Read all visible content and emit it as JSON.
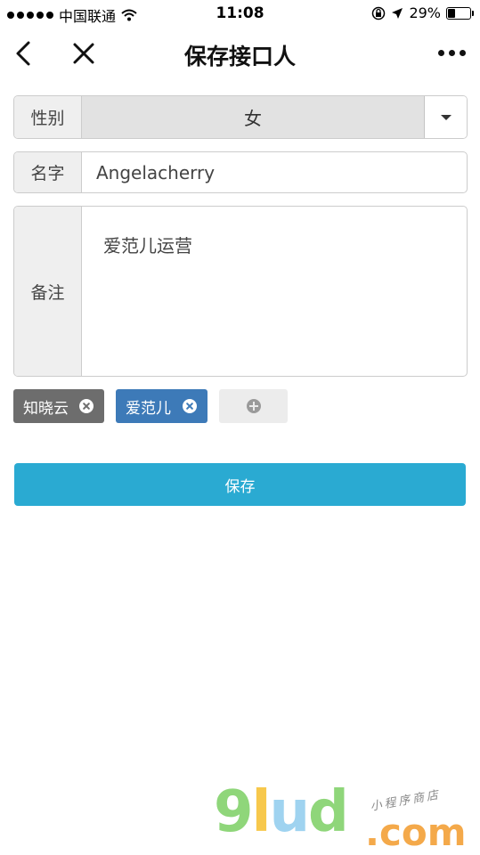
{
  "status_bar": {
    "carrier": "中国联通",
    "time": "11:08",
    "battery_text": "29%",
    "battery_level": 0.29,
    "icons": [
      "signal-dots",
      "wifi-icon",
      "rotation-lock-icon",
      "location-arrow-icon",
      "battery-icon"
    ]
  },
  "nav": {
    "title": "保存接口人",
    "back_icon": "chevron-left-icon",
    "close_icon": "close-icon",
    "more_icon": "more-dots-icon"
  },
  "form": {
    "gender": {
      "label": "性别",
      "value": "女"
    },
    "name": {
      "label": "名字",
      "value": "Angelacherry"
    },
    "note": {
      "label": "备注",
      "value": "爱范儿运营"
    }
  },
  "tags": [
    {
      "text": "知晓云",
      "color": "#6d6d6d"
    },
    {
      "text": "爱范儿",
      "color": "#3d7ab8"
    }
  ],
  "save_button": {
    "label": "保存",
    "color": "#2aaad2"
  },
  "watermark": {
    "logo": "9lud",
    "domain": ".com",
    "subtitle": "小程序商店"
  }
}
